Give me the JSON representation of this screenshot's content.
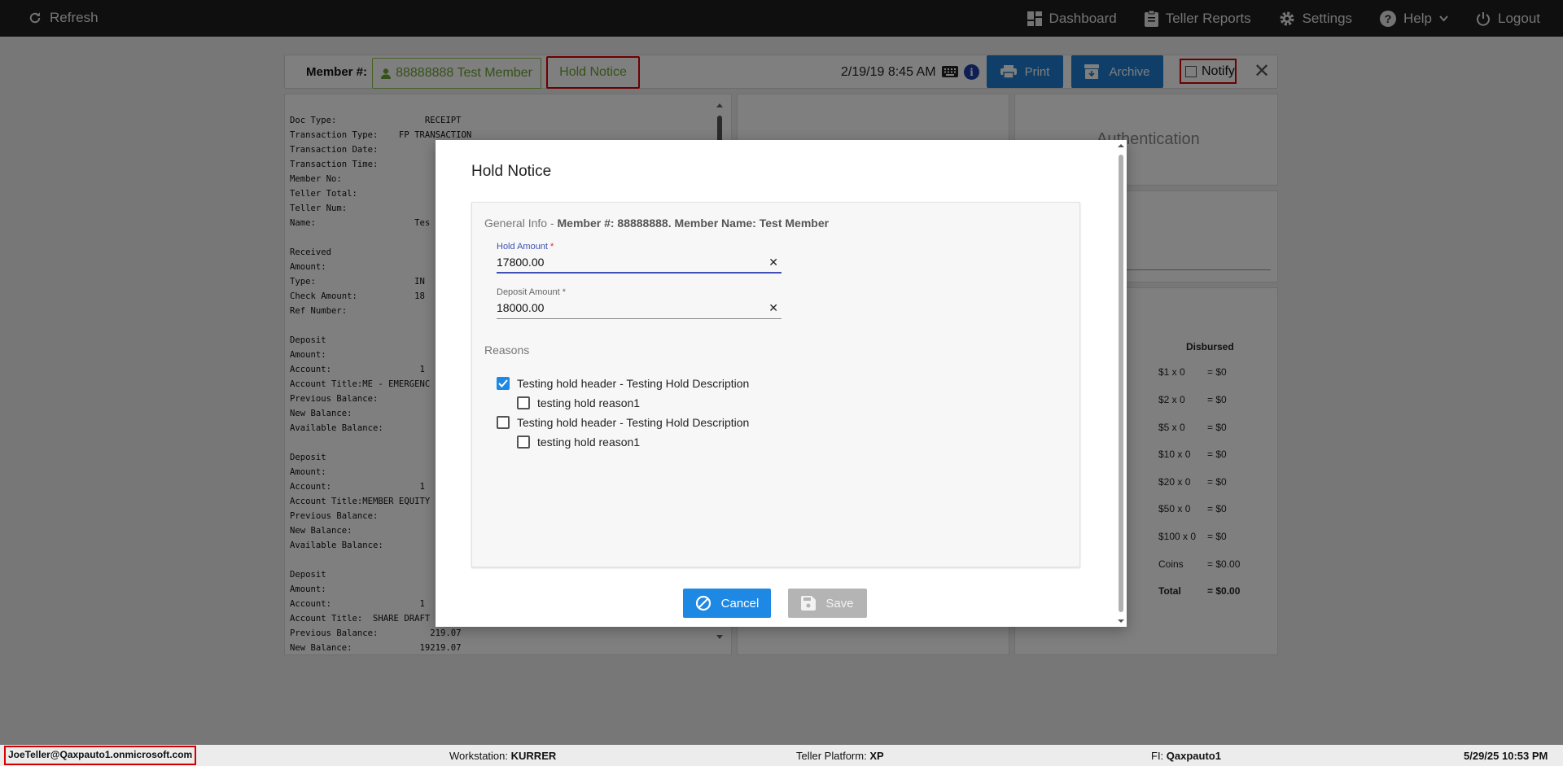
{
  "topbar": {
    "refresh_label": "Refresh",
    "dashboard_label": "Dashboard",
    "teller_reports_label": "Teller Reports",
    "settings_label": "Settings",
    "help_label": "Help",
    "logout_label": "Logout"
  },
  "member_bar": {
    "member_label": "Member #:",
    "member_button": "88888888 Test Member",
    "hold_notice_button": "Hold Notice",
    "datetime": "2/19/19 8:45 AM",
    "print_label": "Print",
    "archive_label": "Archive",
    "notify_label": "Notify"
  },
  "receipt": {
    "lines": "Doc Type:                 RECEIPT\nTransaction Type:    FP TRANSACTION\nTransaction Date:\nTransaction Time:\nMember No:\nTeller Total:\nTeller Num:\nName:                   Tes\n\nReceived\nAmount:\nType:                   IN\nCheck Amount:           18\nRef Number:\n\nDeposit\nAmount:\nAccount:                 1\nAccount Title:ME - EMERGENC\nPrevious Balance:\nNew Balance:\nAvailable Balance:\n\nDeposit\nAmount:\nAccount:                 1\nAccount Title:MEMBER EQUITY\nPrevious Balance:\nNew Balance:\nAvailable Balance:\n\nDeposit\nAmount:\nAccount:                 1\nAccount Title:  SHARE DRAFT\nPrevious Balance:          219.07\nNew Balance:             19219.07"
  },
  "right_panels": {
    "auth_title": "Authentication",
    "disbursed_title": "Disbursed",
    "disbursed_rows": [
      {
        "denom": "$1 x 0",
        "total": "= $0"
      },
      {
        "denom": "$2 x 0",
        "total": "= $0"
      },
      {
        "denom": "$5 x 0",
        "total": "= $0"
      },
      {
        "denom": "$10 x 0",
        "total": "= $0"
      },
      {
        "denom": "$20 x 0",
        "total": "= $0"
      },
      {
        "denom": "$50 x 0",
        "total": "= $0"
      },
      {
        "denom": "$100 x 0",
        "total": "= $0"
      },
      {
        "denom": "Coins",
        "total": "= $0.00"
      },
      {
        "denom": "Total",
        "total": "= $0.00"
      }
    ]
  },
  "modal": {
    "title": "Hold Notice",
    "general_info_prefix": "General Info - ",
    "general_info_bold": "Member #: 88888888. Member Name: Test Member",
    "hold_amount_label": "Hold Amount",
    "hold_amount_value": "17800.00",
    "deposit_amount_label": "Deposit Amount",
    "deposit_amount_value": "18000.00",
    "required_mark": "*",
    "reasons_label": "Reasons",
    "reasons": [
      {
        "label": "Testing hold header - Testing Hold Description",
        "checked": true
      },
      {
        "label": "testing hold reason1",
        "checked": false
      },
      {
        "label": "Testing hold header - Testing Hold Description",
        "checked": false
      },
      {
        "label": "testing hold reason1",
        "checked": false
      }
    ],
    "cancel_label": "Cancel",
    "save_label": "Save"
  },
  "statusbar": {
    "user": "JoeTeller@Qaxpauto1.onmicrosoft.com",
    "workstation_label": "Workstation:",
    "workstation_value": "KURRER",
    "platform_label": "Teller Platform:",
    "platform_value": "XP",
    "fi_label": "FI:",
    "fi_value": "Qaxpauto1",
    "datetime": "5/29/25 10:53 PM"
  },
  "colors": {
    "accent_blue": "#1e88e5",
    "brand_green": "#6aa430",
    "alert_red": "#d60000",
    "topbar_bg": "#1f1f1f"
  }
}
